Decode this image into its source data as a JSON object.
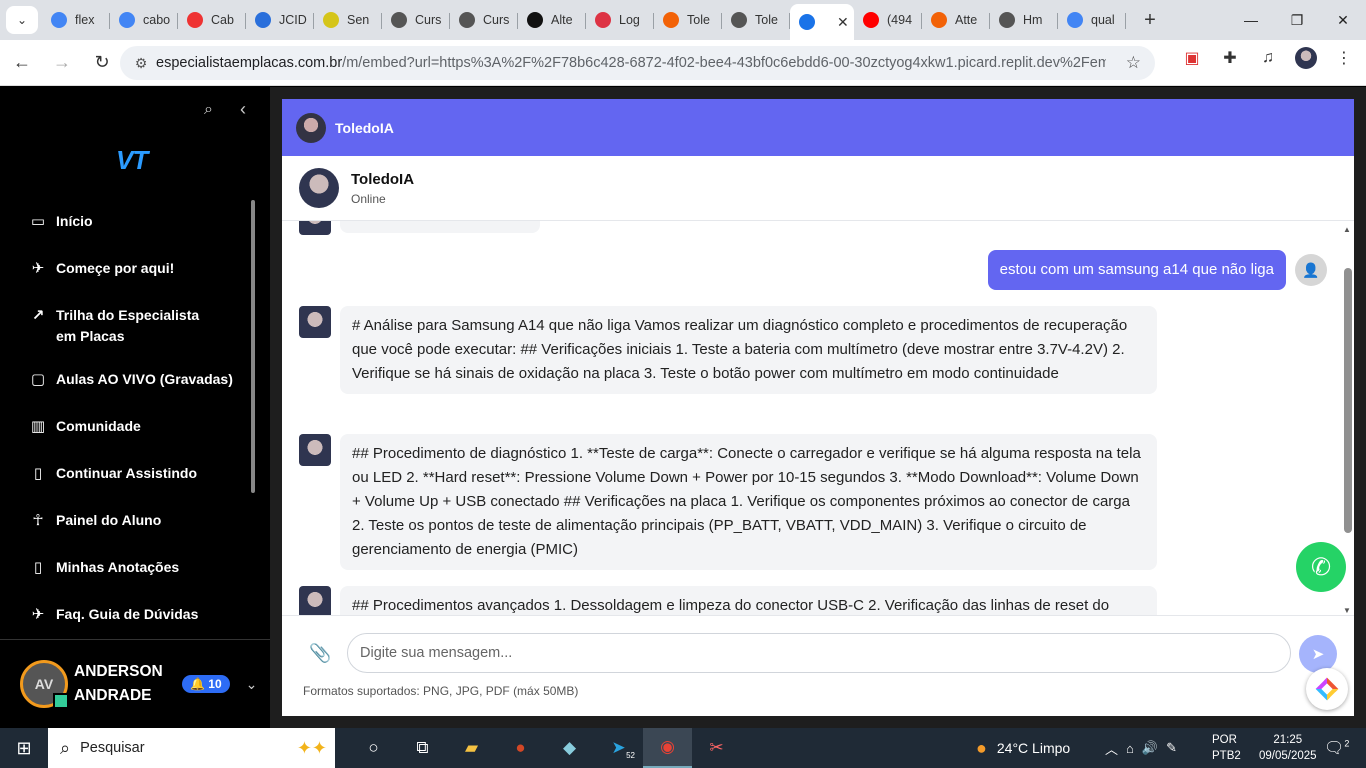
{
  "browser": {
    "tabs": [
      {
        "label": "flex",
        "icon": "google-icon",
        "color": "#4285f4"
      },
      {
        "label": "cabo",
        "icon": "google-icon",
        "color": "#4285f4"
      },
      {
        "label": "Cab",
        "icon": "bookmark-icon",
        "color": "#e33"
      },
      {
        "label": "JCID",
        "icon": "jcid-icon",
        "color": "#2a6fdb"
      },
      {
        "label": "Sen",
        "icon": "wave-icon",
        "color": "#d5c51a"
      },
      {
        "label": "Curs",
        "icon": "course-icon",
        "color": "#555"
      },
      {
        "label": "Curs",
        "icon": "course-icon",
        "color": "#555"
      },
      {
        "label": "Alte",
        "icon": "openai-icon",
        "color": "#111"
      },
      {
        "label": "Log",
        "icon": "login-icon",
        "color": "#d34"
      },
      {
        "label": "Tole",
        "icon": "replit-icon",
        "color": "#f26207"
      },
      {
        "label": "Tole",
        "icon": "globe-icon",
        "color": "#555"
      },
      {
        "label": "",
        "icon": "vt-icon",
        "color": "#1a73e8",
        "active": true
      },
      {
        "label": "(494",
        "icon": "youtube-icon",
        "color": "#f00"
      },
      {
        "label": "Atte",
        "icon": "replit-icon",
        "color": "#f26207"
      },
      {
        "label": "Hm",
        "icon": "globe-icon",
        "color": "#555"
      },
      {
        "label": "qual",
        "icon": "google-icon",
        "color": "#4285f4"
      }
    ],
    "url_host": "especialistaemplacas.com.br",
    "url_path": "/m/embed?url=https%3A%2F%2F78b6c428-6872-4f02-bee4-43bf0c6ebdd6-00-30zctyog4xkw1.picard.replit.dev%2Fembed..."
  },
  "sidebar": {
    "logo": "VT",
    "items": [
      {
        "label": "Início",
        "icon": "home-icon"
      },
      {
        "label": "Começe por aqui!",
        "icon": "plane-icon"
      },
      {
        "label": "Trilha do Especialista em Placas",
        "icon": "trend-icon"
      },
      {
        "label": "Aulas AO VIVO (Gravadas)",
        "icon": "calendar-icon"
      },
      {
        "label": "Comunidade",
        "icon": "bars-icon"
      },
      {
        "label": "Continuar Assistindo",
        "icon": "book-icon"
      },
      {
        "label": "Painel do Aluno",
        "icon": "person-icon"
      },
      {
        "label": "Minhas Anotações",
        "icon": "book-icon"
      },
      {
        "label": "Faq. Guia de Dúvidas",
        "icon": "plane-icon"
      }
    ],
    "user": {
      "initials": "AV",
      "name": "ANDERSON ANDRADE",
      "notifications": "10"
    }
  },
  "chat": {
    "top_title": "ToledoIA",
    "bot_name": "ToledoIA",
    "status": "Online",
    "user_message": "estou com um samsung a14 que não liga",
    "messages": [
      "# Análise para Samsung A14 que não liga Vamos realizar um diagnóstico completo e procedimentos de recuperação que você pode executar: ## Verificações iniciais 1. Teste a bateria com multímetro (deve mostrar entre 3.7V-4.2V) 2. Verifique se há sinais de oxidação na placa 3. Teste o botão power com multímetro em modo continuidade",
      "## Procedimento de diagnóstico 1. **Teste de carga**: Conecte o carregador e verifique se há alguma resposta na tela ou LED 2. **Hard reset**: Pressione Volume Down + Power por 10-15 segundos 3. **Modo Download**: Volume Down + Volume Up + USB conectado ## Verificações na placa 1. Verifique os componentes próximos ao conector de carga 2. Teste os pontos de teste de alimentação principais (PP_BATT, VBATT, VDD_MAIN) 3. Verifique o circuito de gerenciamento de energia (PMIC)",
      "## Procedimentos avançados 1. Dessoldagem e limpeza do conector USB-C 2. Verificação das linhas de reset do"
    ],
    "input_placeholder": "Digite sua mensagem...",
    "formats_note": "Formatos suportados: PNG, JPG, PDF (máx 50MB)"
  },
  "taskbar": {
    "search_placeholder": "Pesquisar",
    "weather": "24°C  Limpo",
    "lang_line1": "POR",
    "lang_line2": "PTB2",
    "time": "21:25",
    "date": "09/05/2025",
    "telegram_badge": "52",
    "notif_count": "2"
  }
}
